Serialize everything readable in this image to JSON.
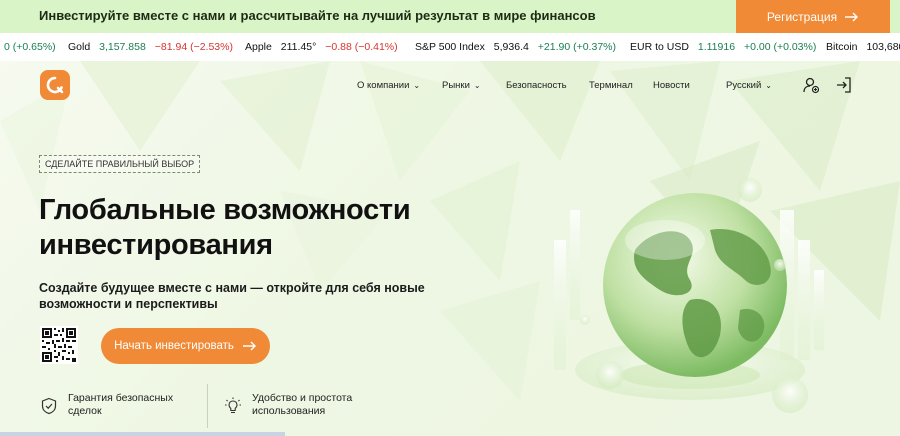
{
  "topbar": {
    "promo_text": "Инвестируйте вместе с нами и рассчитывайте на лучший результат в мире финансов",
    "register_label": "Регистрация"
  },
  "ticker": [
    {
      "name": "",
      "price": "",
      "change": "0 (+0.65%)",
      "direction": "pos"
    },
    {
      "name": "Gold",
      "price": "3,157.858",
      "change": "−81.94 (−2.53%)",
      "direction": "neg"
    },
    {
      "name": "Apple",
      "price": "211.45°",
      "change": "−0.88 (−0.41%)",
      "direction": "neg"
    },
    {
      "name": "S&P 500 Index",
      "price": "5,936.4",
      "change": "+21.90 (+0.37%)",
      "direction": "pos"
    },
    {
      "name": "EUR to USD",
      "price": "1.11916",
      "change": "+0.00 (+0.03%)",
      "direction": "pos"
    },
    {
      "name": "Bitcoin",
      "price": "103,680",
      "change": "",
      "direction": "pos"
    }
  ],
  "nav": {
    "items": [
      {
        "label": "О компании",
        "dropdown": true
      },
      {
        "label": "Рынки",
        "dropdown": true
      },
      {
        "label": "Безопасность",
        "dropdown": false
      },
      {
        "label": "Терминал",
        "dropdown": false
      },
      {
        "label": "Новости",
        "dropdown": false
      }
    ],
    "language": "Русский"
  },
  "hero": {
    "tag": "СДЕЛАЙТЕ ПРАВИЛЬНЫЙ ВЫБОР",
    "title_line1": "Глобальные возможности",
    "title_line2": "инвестирования",
    "subtitle_line1": "Создайте будущее вместе с нами — откройте для себя новые",
    "subtitle_line2": "возможности и перспективы",
    "cta_label": "Начать инвестировать"
  },
  "features": [
    {
      "line1": "Гарантия безопасных",
      "line2": "сделок",
      "icon": "shield-check-icon"
    },
    {
      "line1": "Удобство и простота",
      "line2": "использования",
      "icon": "lightbulb-icon"
    }
  ],
  "colors": {
    "accent": "#f08a36",
    "banner": "#d9f5c8",
    "positive": "#1a7f52",
    "negative": "#d8342e"
  }
}
